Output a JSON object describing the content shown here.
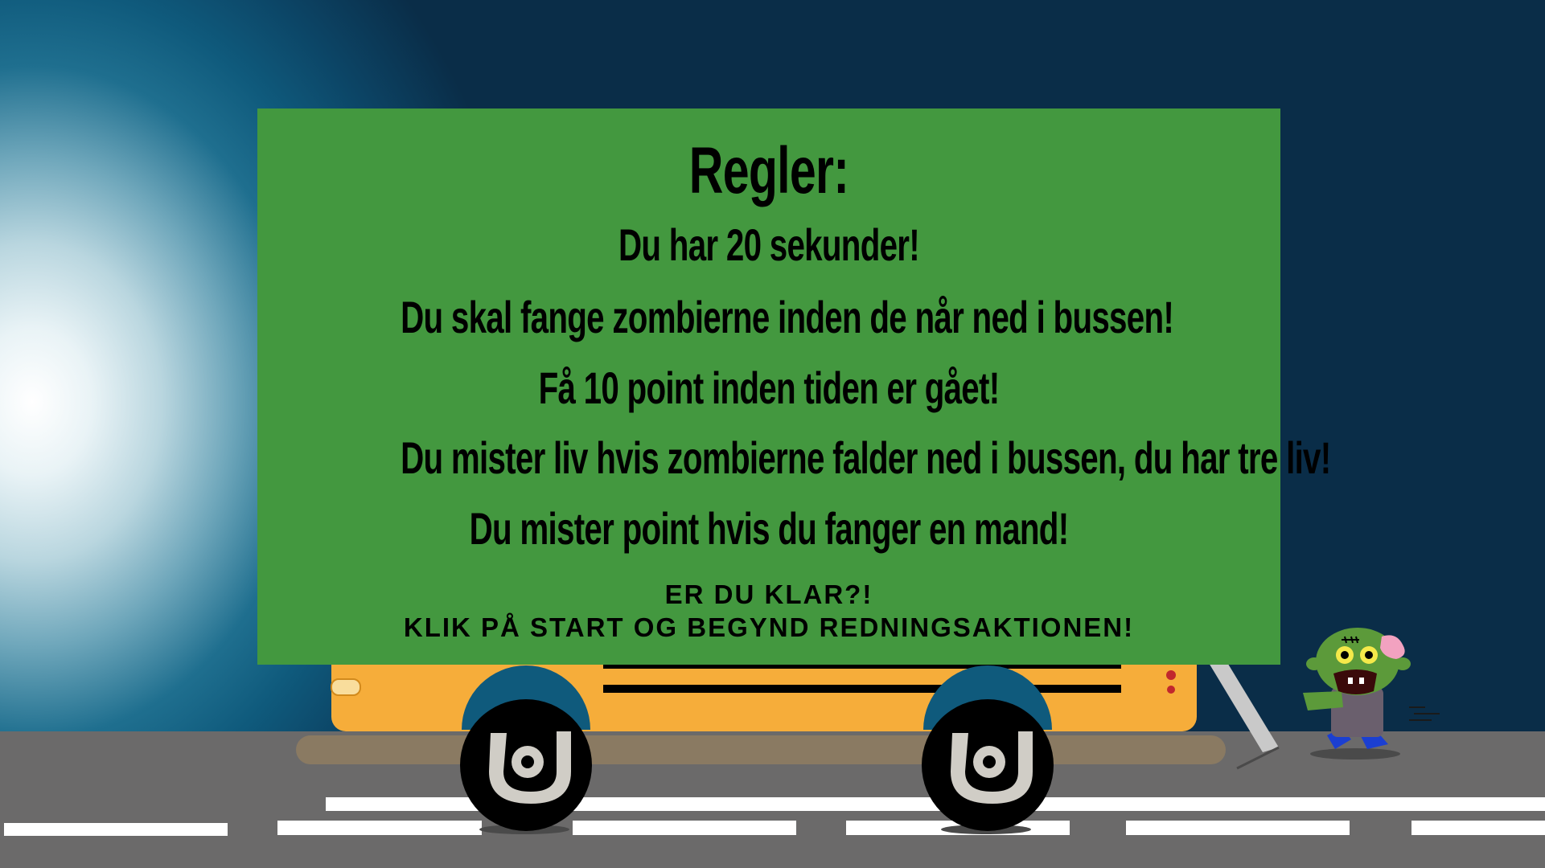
{
  "rules": {
    "title": "Regler:",
    "lines": [
      "Du har 20 sekunder!",
      "Du skal fange zombierne inden de når ned i bussen!",
      "Få 10 point inden tiden er gået!",
      "Du mister liv hvis zombierne falder ned i bussen, du har tre liv!",
      "Du mister point hvis du fanger en mand!"
    ],
    "ready": "ER DU KLAR?!",
    "instruction": "KLIK PÅ START OG BEGYND REDNINGSAKTIONEN!"
  },
  "colors": {
    "panel_green": "#43983f",
    "bus_yellow": "#f6ad3a",
    "road_gray": "#6b6a6a",
    "zombie_green": "#5c9a3a",
    "sky_dark": "#0a2d48"
  },
  "icons": {
    "bus": "school-bus",
    "zombie": "zombie-character",
    "wheel": "wheel"
  }
}
